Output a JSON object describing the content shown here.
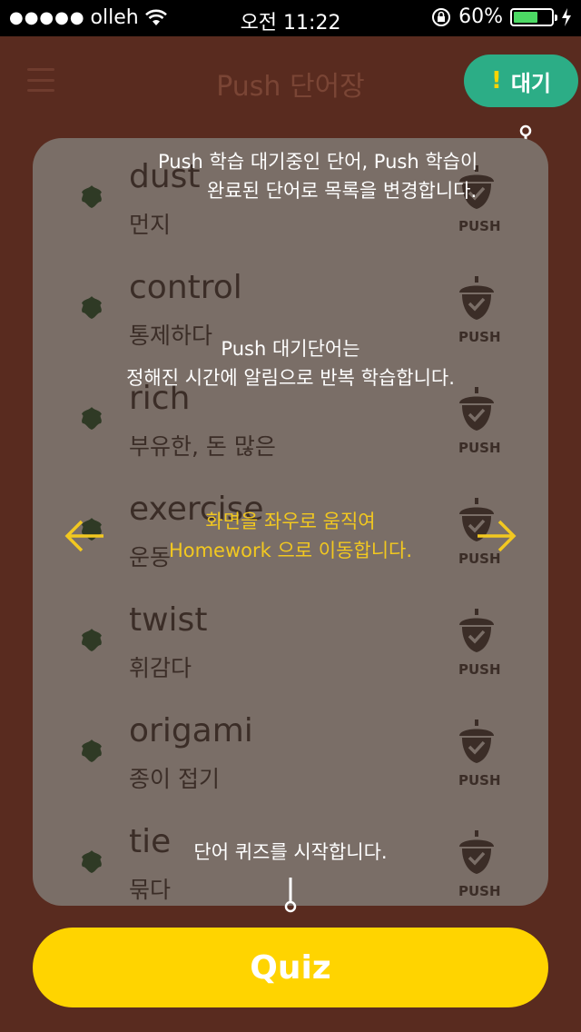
{
  "status_bar": {
    "carrier": "olleh",
    "signal_dots": "●●●●●",
    "time": "오전 11:22",
    "battery": "60%"
  },
  "header": {
    "title": "Push 단어장",
    "wait_button_mark": "!",
    "wait_button_label": "대기"
  },
  "words": [
    {
      "en": "dust",
      "ko": "먼지",
      "badge": "PUSH"
    },
    {
      "en": "control",
      "ko": "통제하다",
      "badge": "PUSH"
    },
    {
      "en": "rich",
      "ko": "부유한, 돈 많은",
      "badge": "PUSH"
    },
    {
      "en": "exercise",
      "ko": "운동",
      "badge": "PUSH"
    },
    {
      "en": "twist",
      "ko": "휘감다",
      "badge": "PUSH"
    },
    {
      "en": "origami",
      "ko": "종이 접기",
      "badge": "PUSH"
    },
    {
      "en": "tie",
      "ko": "묶다",
      "badge": "PUSH"
    }
  ],
  "tips": {
    "list_toggle_line1": "Push 학습 대기중인 단어, Push 학습이",
    "list_toggle_line2": "완료된 단어로 목록을 변경합니다.",
    "push_line1": "Push 대기단어는",
    "push_line2": "정해진 시간에 알림으로 반복 학습합니다.",
    "swipe_line1": "화면을 좌우로 움직여",
    "swipe_line2": "Homework 으로 이동합니다.",
    "quiz_tip": "단어 퀴즈를 시작합니다."
  },
  "quiz_button": "Quiz",
  "colors": {
    "background": "#592b1f",
    "card": "#7a6e67",
    "wait_button": "#2cad86",
    "quiz_button": "#ffd400",
    "tip_yellow": "#f2c820"
  }
}
